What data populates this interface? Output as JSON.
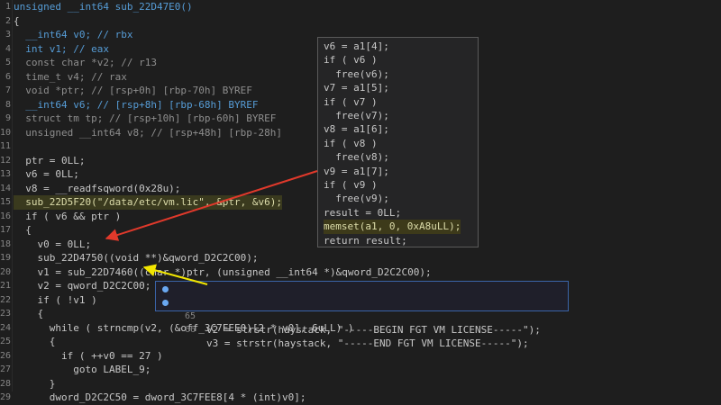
{
  "editor": {
    "lines": [
      {
        "n": "1",
        "text": "unsigned __int64 sub_22D47E0()"
      },
      {
        "n": "2",
        "text": "{"
      },
      {
        "n": "3",
        "text": "  __int64 v0; // rbx"
      },
      {
        "n": "4",
        "text": "  int v1; // eax"
      },
      {
        "n": "5",
        "text": "  const char *v2; // r13"
      },
      {
        "n": "6",
        "text": "  time_t v4; // rax"
      },
      {
        "n": "7",
        "text": "  void *ptr; // [rsp+0h] [rbp-70h] BYREF"
      },
      {
        "n": "8",
        "text": "  __int64 v6; // [rsp+8h] [rbp-68h] BYREF"
      },
      {
        "n": "9",
        "text": "  struct tm tp; // [rsp+10h] [rbp-60h] BYREF"
      },
      {
        "n": "10",
        "text": "  unsigned __int64 v8; // [rsp+48h] [rbp-28h]"
      },
      {
        "n": "11",
        "text": ""
      },
      {
        "n": "12",
        "text": "  ptr = 0LL;"
      },
      {
        "n": "13",
        "text": "  v6 = 0LL;"
      },
      {
        "n": "14",
        "text": "  v8 = __readfsqword(0x28u);"
      },
      {
        "n": "15",
        "text": "  sub_22D5F20(\"/data/etc/vm.lic\", &ptr, &v6);"
      },
      {
        "n": "16",
        "text": "  if ( v6 && ptr )"
      },
      {
        "n": "17",
        "text": "  {"
      },
      {
        "n": "18",
        "text": "    v0 = 0LL;"
      },
      {
        "n": "19",
        "text": "    sub_22D4750((void **)&qword_D2C2C00);"
      },
      {
        "n": "20",
        "text": "    v1 = sub_22D7460((char *)ptr, (unsigned __int64 *)&qword_D2C2C00);"
      },
      {
        "n": "21",
        "text": "    v2 = qword_D2C2C00;"
      },
      {
        "n": "22",
        "text": "    if ( !v1 )"
      },
      {
        "n": "23",
        "text": "    {"
      },
      {
        "n": "24",
        "text": "      while ( strncmp(v2, (&off_3C7FEE0)[2 * v0], 6uLL) )"
      },
      {
        "n": "25",
        "text": "      {"
      },
      {
        "n": "26",
        "text": "        if ( ++v0 == 27 )"
      },
      {
        "n": "27",
        "text": "          goto LABEL_9;"
      },
      {
        "n": "28",
        "text": "      }"
      },
      {
        "n": "29",
        "text": "      dword_D2C2C50 = dword_3C7FEE8[4 * (int)v0];"
      }
    ]
  },
  "popup_free": {
    "lines": [
      "v6 = a1[4];",
      "if ( v6 )",
      "  free(v6);",
      "v7 = a1[5];",
      "if ( v7 )",
      "  free(v7);",
      "v8 = a1[6];",
      "if ( v8 )",
      "  free(v8);",
      "v9 = a1[7];",
      "if ( v9 )",
      "  free(v9);",
      "result = 0LL;",
      "memset(a1, 0, 0xA8uLL);",
      "return result;"
    ]
  },
  "popup_license": {
    "rows": [
      {
        "n": "65",
        "text": "v2 = strstr(haystack, \"-----BEGIN FGT VM LICENSE-----\");"
      },
      {
        "n": "66",
        "text": "v3 = strstr(haystack, \"-----END FGT VM LICENSE-----\");"
      }
    ]
  },
  "colors": {
    "background": "#1e1e1e",
    "keyword": "#c586c0",
    "string": "#ce9178",
    "function": "#dcdcaa",
    "arrow_red": "#e0392b",
    "arrow_yellow": "#f2e600",
    "popup_border": "#3a64a8"
  },
  "icons": [
    "breakpoint-dot-icon"
  ]
}
